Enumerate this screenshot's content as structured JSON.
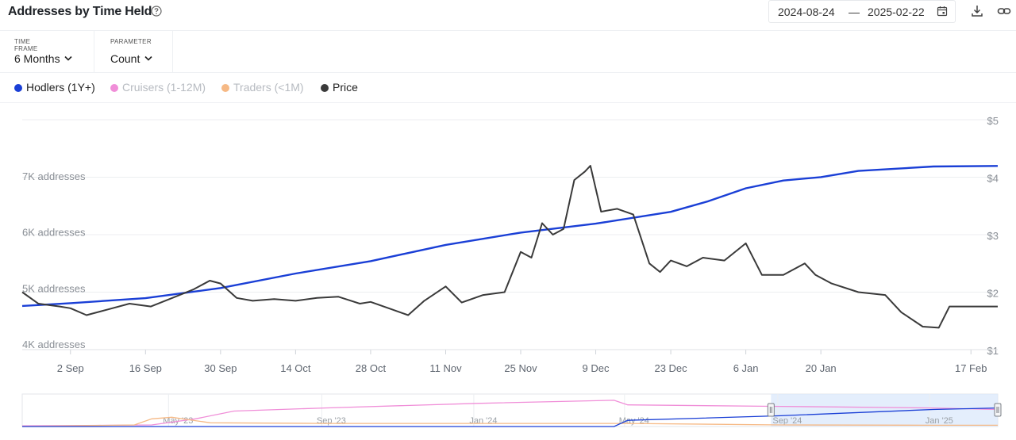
{
  "header": {
    "title": "Addresses by Time Held",
    "date_start": "2024-08-24",
    "date_sep": "—",
    "date_end": "2025-02-22"
  },
  "controls": {
    "time_frame_label": "TIME FRAME",
    "time_frame_value": "6 Months",
    "parameter_label": "PARAMETER",
    "parameter_value": "Count"
  },
  "icons": [
    "help-icon",
    "calendar-icon",
    "download-icon",
    "link-icon",
    "chevron-down-icon"
  ],
  "colors": {
    "hodlers": "#1a3fd6",
    "cruisers": "#f08ed8",
    "traders": "#f6b985",
    "price": "#3a3a3a",
    "grid": "#eceef1",
    "axis_text": "#8a8f96",
    "navigator_highlight": "#dbe8fb"
  },
  "chart_data": [
    {
      "type": "line",
      "legend_position": "top-left",
      "legend": [
        {
          "name": "Hodlers (1Y+)",
          "active": true
        },
        {
          "name": "Cruisers (1-12M)",
          "active": false
        },
        {
          "name": "Traders (<1M)",
          "active": false
        },
        {
          "name": "Price",
          "active": true
        }
      ],
      "x_range": [
        "2024-08-24",
        "2025-02-22"
      ],
      "x_ticks": [
        {
          "date": "2024-09-02",
          "label": "2 Sep"
        },
        {
          "date": "2024-09-16",
          "label": "16 Sep"
        },
        {
          "date": "2024-09-30",
          "label": "30 Sep"
        },
        {
          "date": "2024-10-14",
          "label": "14 Oct"
        },
        {
          "date": "2024-10-28",
          "label": "28 Oct"
        },
        {
          "date": "2024-11-11",
          "label": "11 Nov"
        },
        {
          "date": "2024-11-25",
          "label": "25 Nov"
        },
        {
          "date": "2024-12-09",
          "label": "9 Dec"
        },
        {
          "date": "2024-12-23",
          "label": "23 Dec"
        },
        {
          "date": "2025-01-06",
          "label": "6 Jan"
        },
        {
          "date": "2025-01-20",
          "label": "20 Jan"
        },
        {
          "date": "2025-02-17",
          "label": "17 Feb"
        }
      ],
      "y_left": {
        "min": 4000,
        "max": 7000,
        "ticks": [
          {
            "value": 4000,
            "label": "4K addresses"
          },
          {
            "value": 5000,
            "label": "5K addresses"
          },
          {
            "value": 6000,
            "label": "6K addresses"
          },
          {
            "value": 7000,
            "label": "7K addresses"
          }
        ]
      },
      "y_right": {
        "min": 1,
        "max": 5,
        "ticks": [
          {
            "value": 1,
            "label": "$1"
          },
          {
            "value": 2,
            "label": "$2"
          },
          {
            "value": 3,
            "label": "$3"
          },
          {
            "value": 4,
            "label": "$4"
          },
          {
            "value": 5,
            "label": "$5"
          }
        ]
      },
      "grid": true,
      "series": [
        {
          "name": "Hodlers (1Y+)",
          "axis": "left",
          "points": [
            [
              "2024-08-24",
              4680
            ],
            [
              "2024-09-02",
              4730
            ],
            [
              "2024-09-16",
              4820
            ],
            [
              "2024-09-30",
              5000
            ],
            [
              "2024-10-14",
              5260
            ],
            [
              "2024-10-28",
              5480
            ],
            [
              "2024-11-11",
              5770
            ],
            [
              "2024-11-25",
              5990
            ],
            [
              "2024-12-09",
              6150
            ],
            [
              "2024-12-23",
              6360
            ],
            [
              "2024-12-30",
              6550
            ],
            [
              "2025-01-06",
              6780
            ],
            [
              "2025-01-13",
              6920
            ],
            [
              "2025-01-20",
              6980
            ],
            [
              "2025-01-27",
              7090
            ],
            [
              "2025-02-03",
              7130
            ],
            [
              "2025-02-10",
              7170
            ],
            [
              "2025-02-22",
              7180
            ]
          ]
        },
        {
          "name": "Price",
          "axis": "right",
          "points": [
            [
              "2024-08-24",
              2.0
            ],
            [
              "2024-08-27",
              1.8
            ],
            [
              "2024-08-31",
              1.75
            ],
            [
              "2024-09-02",
              1.72
            ],
            [
              "2024-09-05",
              1.6
            ],
            [
              "2024-09-09",
              1.7
            ],
            [
              "2024-09-13",
              1.8
            ],
            [
              "2024-09-17",
              1.75
            ],
            [
              "2024-09-21",
              1.9
            ],
            [
              "2024-09-25",
              2.05
            ],
            [
              "2024-09-28",
              2.2
            ],
            [
              "2024-09-30",
              2.15
            ],
            [
              "2024-10-03",
              1.9
            ],
            [
              "2024-10-06",
              1.85
            ],
            [
              "2024-10-10",
              1.88
            ],
            [
              "2024-10-14",
              1.85
            ],
            [
              "2024-10-18",
              1.9
            ],
            [
              "2024-10-22",
              1.92
            ],
            [
              "2024-10-26",
              1.8
            ],
            [
              "2024-10-28",
              1.83
            ],
            [
              "2024-11-01",
              1.7
            ],
            [
              "2024-11-04",
              1.6
            ],
            [
              "2024-11-07",
              1.85
            ],
            [
              "2024-11-11",
              2.1
            ],
            [
              "2024-11-14",
              1.82
            ],
            [
              "2024-11-18",
              1.95
            ],
            [
              "2024-11-22",
              2.0
            ],
            [
              "2024-11-25",
              2.7
            ],
            [
              "2024-11-27",
              2.6
            ],
            [
              "2024-11-29",
              3.2
            ],
            [
              "2024-12-01",
              3.0
            ],
            [
              "2024-12-03",
              3.1
            ],
            [
              "2024-12-05",
              3.95
            ],
            [
              "2024-12-07",
              4.1
            ],
            [
              "2024-12-08",
              4.2
            ],
            [
              "2024-12-10",
              3.4
            ],
            [
              "2024-12-13",
              3.45
            ],
            [
              "2024-12-16",
              3.35
            ],
            [
              "2024-12-19",
              2.5
            ],
            [
              "2024-12-21",
              2.35
            ],
            [
              "2024-12-23",
              2.55
            ],
            [
              "2024-12-26",
              2.45
            ],
            [
              "2024-12-29",
              2.6
            ],
            [
              "2025-01-02",
              2.55
            ],
            [
              "2025-01-06",
              2.85
            ],
            [
              "2025-01-09",
              2.3
            ],
            [
              "2025-01-13",
              2.3
            ],
            [
              "2025-01-17",
              2.5
            ],
            [
              "2025-01-19",
              2.3
            ],
            [
              "2025-01-22",
              2.15
            ],
            [
              "2025-01-27",
              2.0
            ],
            [
              "2025-02-01",
              1.95
            ],
            [
              "2025-02-04",
              1.65
            ],
            [
              "2025-02-08",
              1.4
            ],
            [
              "2025-02-11",
              1.38
            ],
            [
              "2025-02-13",
              1.75
            ],
            [
              "2025-02-22",
              1.75
            ]
          ]
        }
      ]
    },
    {
      "type": "line",
      "role": "navigator",
      "x_range": [
        "2023-01-01",
        "2025-02-22"
      ],
      "x_ticks": [
        {
          "date": "2023-05-01",
          "label": "May '23"
        },
        {
          "date": "2023-09-01",
          "label": "Sep '23"
        },
        {
          "date": "2024-01-01",
          "label": "Jan '24"
        },
        {
          "date": "2024-05-01",
          "label": "May '24"
        },
        {
          "date": "2024-09-01",
          "label": "Sep '24"
        },
        {
          "date": "2025-01-01",
          "label": "Jan '25"
        }
      ],
      "selected_range": [
        "2024-08-24",
        "2025-02-22"
      ],
      "series": [
        {
          "name": "Cruisers (1-12M)",
          "points": [
            [
              "2023-01-01",
              0.02
            ],
            [
              "2023-04-15",
              0.05
            ],
            [
              "2023-05-20",
              0.25
            ],
            [
              "2023-06-20",
              0.5
            ],
            [
              "2023-09-01",
              0.6
            ],
            [
              "2024-01-01",
              0.75
            ],
            [
              "2024-04-20",
              0.85
            ],
            [
              "2024-05-01",
              0.7
            ],
            [
              "2024-09-01",
              0.65
            ],
            [
              "2025-01-01",
              0.6
            ],
            [
              "2025-02-22",
              0.55
            ]
          ]
        },
        {
          "name": "Traders (<1M)",
          "points": [
            [
              "2023-01-01",
              0.0
            ],
            [
              "2023-04-01",
              0.05
            ],
            [
              "2023-04-15",
              0.25
            ],
            [
              "2023-05-01",
              0.3
            ],
            [
              "2023-06-01",
              0.12
            ],
            [
              "2023-09-01",
              0.1
            ],
            [
              "2024-01-01",
              0.1
            ],
            [
              "2024-05-01",
              0.1
            ],
            [
              "2024-09-01",
              0.05
            ],
            [
              "2025-01-01",
              0.04
            ],
            [
              "2025-02-22",
              0.04
            ]
          ]
        },
        {
          "name": "Hodlers (1Y+)",
          "points": [
            [
              "2023-01-01",
              0.0
            ],
            [
              "2024-04-20",
              0.0
            ],
            [
              "2024-05-01",
              0.2
            ],
            [
              "2024-09-01",
              0.35
            ],
            [
              "2025-01-01",
              0.55
            ],
            [
              "2025-02-22",
              0.6
            ]
          ]
        }
      ]
    }
  ]
}
